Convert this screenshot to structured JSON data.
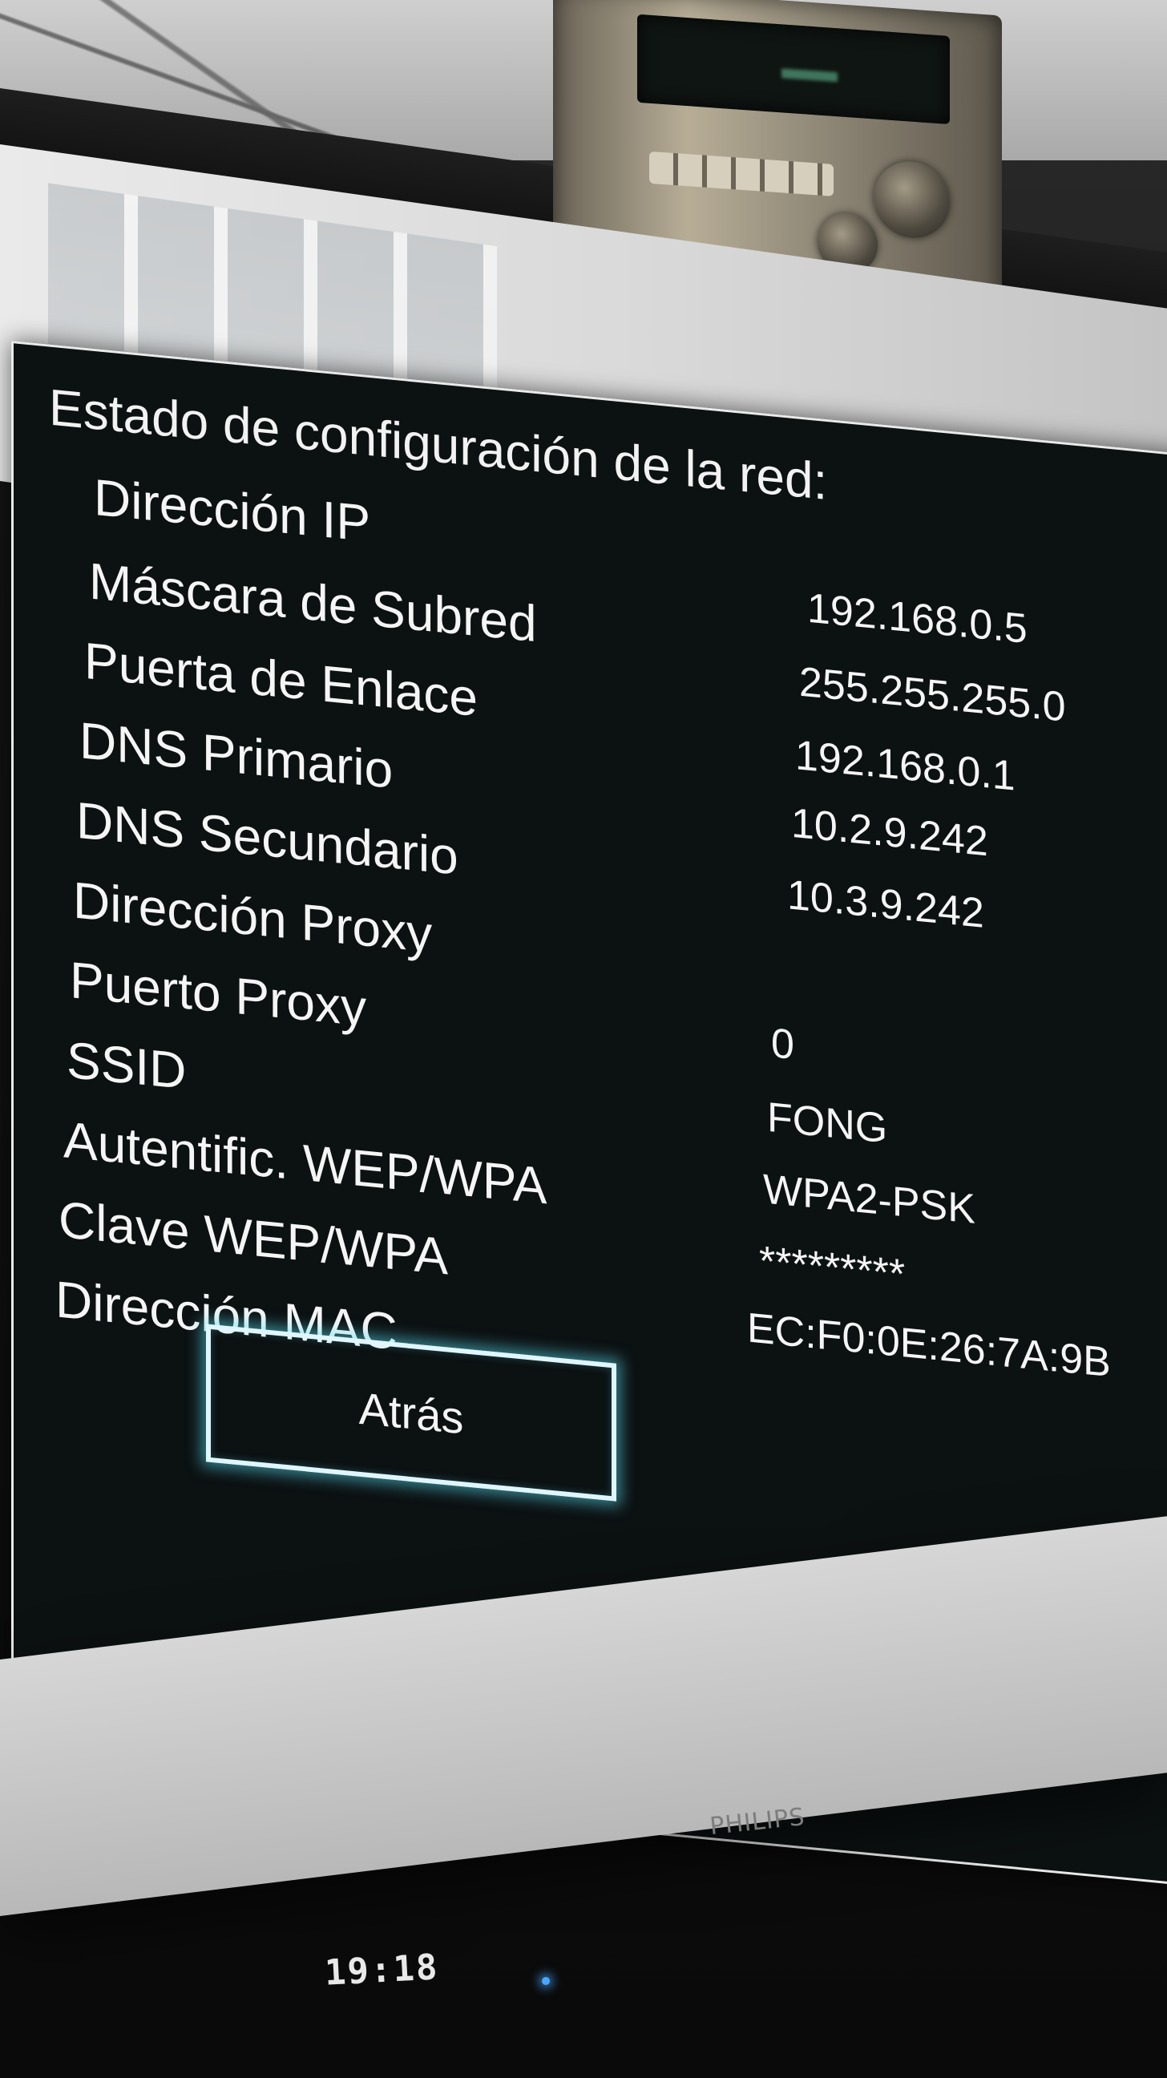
{
  "osd": {
    "title": "Estado de configuración de la red:",
    "rows": [
      {
        "label": "Dirección IP",
        "value": ""
      },
      {
        "label": "Máscara de Subred",
        "value": "192.168.0.5"
      },
      {
        "label": "Puerta de Enlace",
        "value": "255.255.255.0"
      },
      {
        "label": "DNS Primario",
        "value": "192.168.0.1"
      },
      {
        "label": "DNS Secundario",
        "value": "10.2.9.242"
      },
      {
        "label": "Dirección Proxy",
        "value": "10.3.9.242"
      },
      {
        "label": "Puerto Proxy",
        "value": ""
      },
      {
        "label": "SSID",
        "value": "0"
      },
      {
        "label": "Autentific. WEP/WPA",
        "value": "FONG"
      },
      {
        "label": "Clave WEP/WPA",
        "value": "WPA2-PSK"
      },
      {
        "label": "Dirección MAC",
        "value": "*********"
      }
    ],
    "extra_value": "EC:F0:0E:26:7A:9B",
    "back_button_label": "Atrás"
  },
  "tv": {
    "brand": "PHILIPS",
    "clock": "19:18"
  },
  "colors": {
    "panel_bg": "#0c1112",
    "panel_border": "#eaeaea",
    "button_glow": "#5adcf0",
    "text": "#f5f5f5"
  }
}
